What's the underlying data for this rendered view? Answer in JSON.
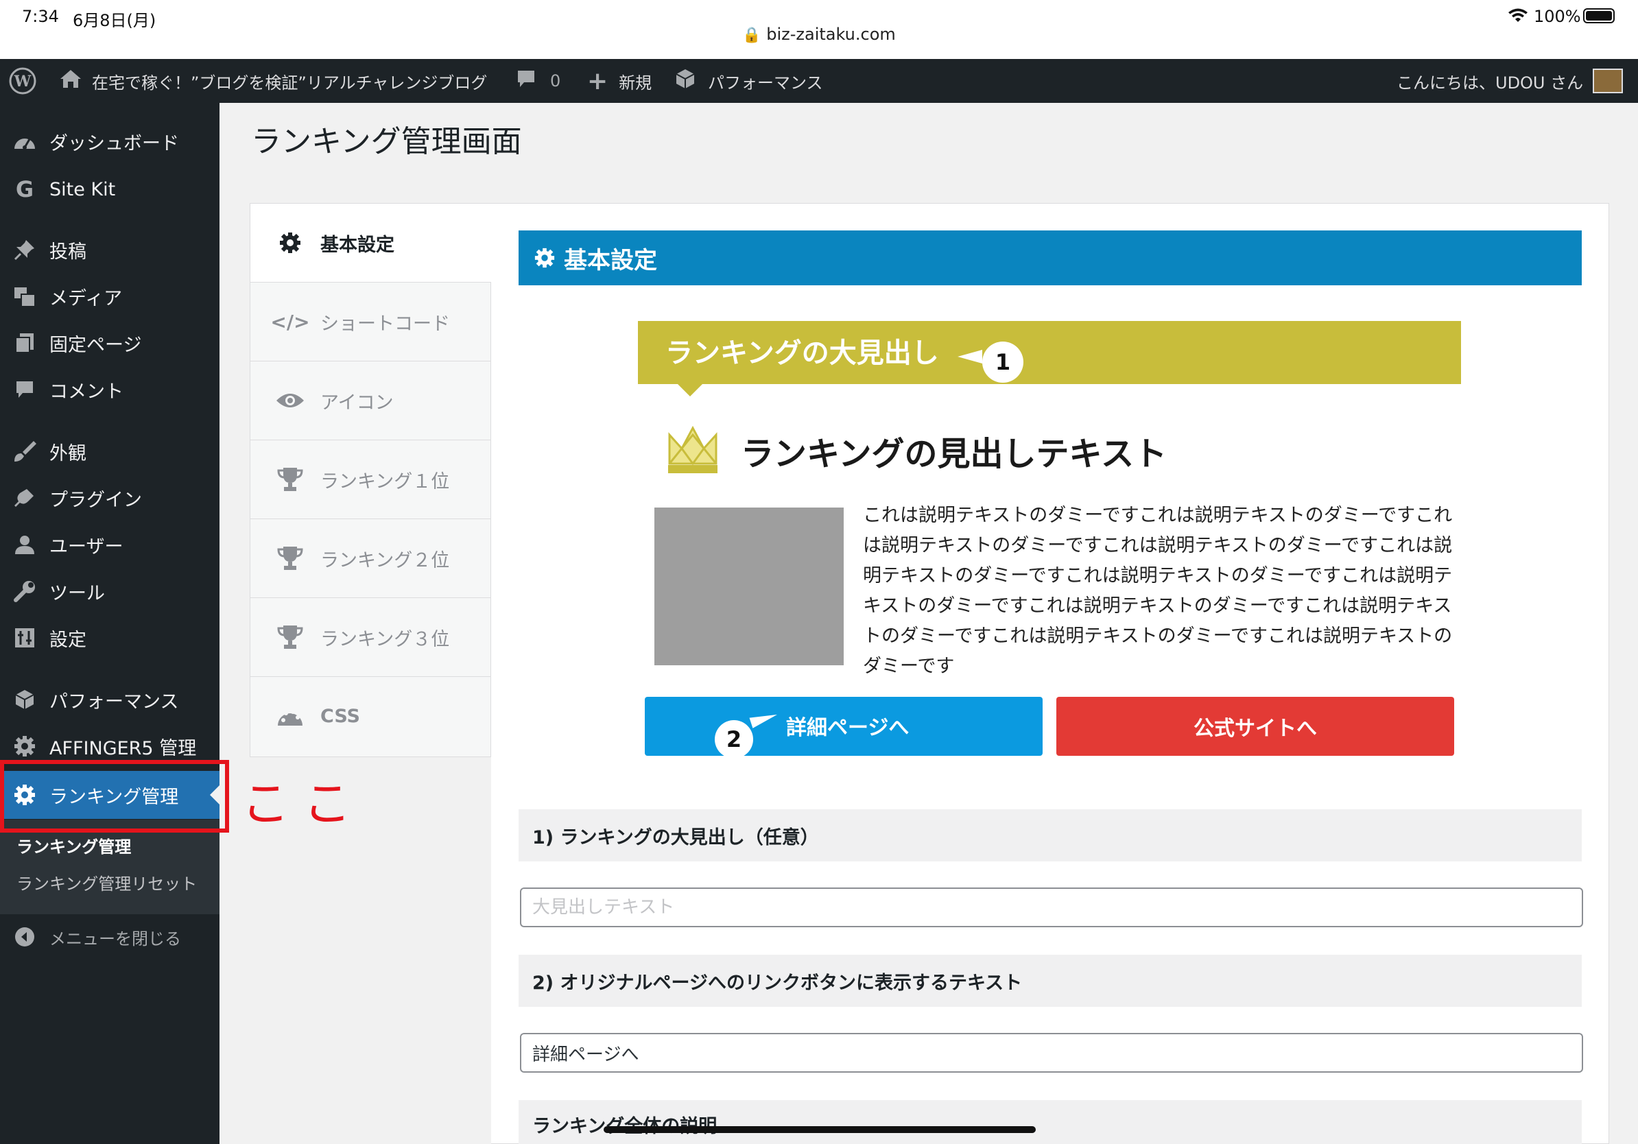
{
  "status_bar": {
    "time": "7:34",
    "date": "6月8日(月)",
    "url": "biz-zaitaku.com",
    "battery": "100%"
  },
  "admin_bar": {
    "site_name": "在宅で稼ぐ！”ブログを検証”リアルチャレンジブログ",
    "comments_count": "0",
    "new_label": "新規",
    "performance_label": "パフォーマンス",
    "greeting": "こんにちは、UDOU さん"
  },
  "sidebar": {
    "items": [
      {
        "label": "ダッシュボード",
        "icon": "dashboard-icon"
      },
      {
        "label": "Site Kit",
        "icon": "google-g-icon"
      },
      {
        "label": "投稿",
        "icon": "pin-icon"
      },
      {
        "label": "メディア",
        "icon": "media-icon"
      },
      {
        "label": "固定ページ",
        "icon": "pages-icon"
      },
      {
        "label": "コメント",
        "icon": "comment-icon"
      },
      {
        "label": "外観",
        "icon": "brush-icon"
      },
      {
        "label": "プラグイン",
        "icon": "plugin-icon"
      },
      {
        "label": "ユーザー",
        "icon": "user-icon"
      },
      {
        "label": "ツール",
        "icon": "wrench-icon"
      },
      {
        "label": "設定",
        "icon": "settings-icon"
      },
      {
        "label": "パフォーマンス",
        "icon": "performance-icon"
      },
      {
        "label": "AFFINGER5 管理",
        "icon": "gear-icon"
      },
      {
        "label": "ランキング管理",
        "icon": "gear-icon"
      }
    ],
    "submenu": [
      "ランキング管理",
      "ランキング管理リセット"
    ],
    "collapse_label": "メニューを閉じる"
  },
  "annotation": {
    "text": "ここ",
    "color": "#e5141c"
  },
  "page": {
    "title": "ランキング管理画面",
    "tabs": [
      {
        "label": "基本設定",
        "icon": "gear-icon",
        "active": true
      },
      {
        "label": "ショートコード",
        "icon": "code-icon"
      },
      {
        "label": "アイコン",
        "icon": "eye-icon"
      },
      {
        "label": "ランキング１位",
        "icon": "trophy-icon"
      },
      {
        "label": "ランキング２位",
        "icon": "trophy-icon"
      },
      {
        "label": "ランキング３位",
        "icon": "trophy-icon"
      },
      {
        "label": "CSS",
        "icon": "palette-icon"
      }
    ],
    "panel_header": "基本設定",
    "preview": {
      "ribbon_text": "ランキングの大見出し",
      "badge1": "1",
      "heading": "ランキングの見出しテキスト",
      "description": "これは説明テキストのダミーですこれは説明テキストのダミーですこれは説明テキストのダミーですこれは説明テキストのダミーですこれは説明テキストのダミーですこれは説明テキストのダミーですこれは説明テキストのダミーですこれは説明テキストのダミーですこれは説明テキストのダミーですこれは説明テキストのダミーですこれは説明テキストのダミーです",
      "detail_button": "詳細ページへ",
      "badge2": "2",
      "official_button": "公式サイトへ"
    },
    "fields": [
      {
        "label": "1) ランキングの大見出し（任意）",
        "value": "",
        "placeholder": "大見出しテキスト"
      },
      {
        "label": "2) オリジナルページへのリンクボタンに表示するテキスト",
        "value": "詳細ページへ",
        "placeholder": ""
      },
      {
        "label": "ランキング全体の説明"
      }
    ]
  },
  "colors": {
    "admin_bar": "#1d2327",
    "accent": "#2271b1",
    "panel_header": "#0a85bf",
    "ribbon": "#c8bd3b",
    "detail_btn": "#0b9ae0",
    "official_btn": "#e33a35"
  }
}
